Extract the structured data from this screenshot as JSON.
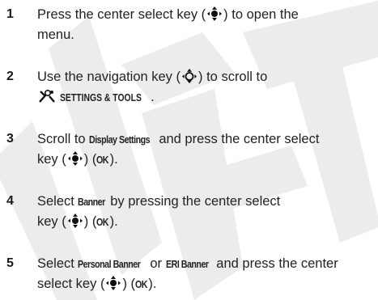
{
  "watermark": {
    "text": "DRAFT",
    "color": "#e9e9e9"
  },
  "steps": [
    {
      "number": "1",
      "text_a": "Press the center select key (",
      "text_b": ") to open the",
      "text_c": "menu."
    },
    {
      "number": "2",
      "text_a": "Use the navigation key (",
      "text_b": ") to scroll to",
      "menu_item": "SETTINGS & TOOLS",
      "text_c": "."
    },
    {
      "number": "3",
      "text_a": "Scroll to ",
      "bold_a": "Display Settings",
      "text_b": " and press the center select",
      "text_c": "key (",
      "text_d": ") (",
      "bold_b": "OK",
      "text_e": ")."
    },
    {
      "number": "4",
      "text_a": "Select ",
      "bold_a": "Banner",
      "text_b": " by pressing the center select",
      "text_c": "key (",
      "text_d": ") (",
      "bold_b": "OK",
      "text_e": ")."
    },
    {
      "number": "5",
      "text_a": "Select ",
      "bold_a": "Personal Banner",
      "text_b": " or ",
      "bold_b": "ERI Banner",
      "text_c": " and press the center",
      "text_d": "select key (",
      "text_e": ") (",
      "bold_c": "OK",
      "text_f": ")."
    }
  ],
  "icons": {
    "select_key": "center-select-key-icon",
    "nav_key": "navigation-key-icon",
    "tools": "settings-tools-icon"
  }
}
